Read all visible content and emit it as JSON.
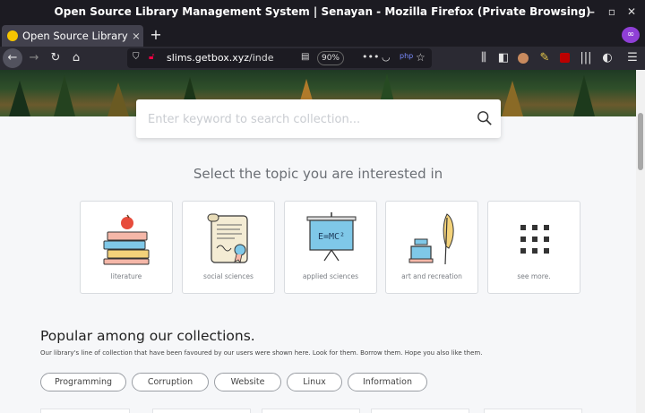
{
  "window": {
    "title": "Open Source Library Management System | Senayan - Mozilla Firefox (Private Browsing)"
  },
  "tab": {
    "label": "Open Source Library Ma",
    "close": "×"
  },
  "nav": {
    "url_host": "slims.getbox.xyz",
    "url_path": "/index.ph",
    "zoom": "90%"
  },
  "search": {
    "placeholder": "Enter keyword to search collection..."
  },
  "topics": {
    "heading": "Select the topic you are interested in",
    "items": [
      {
        "label": "literature",
        "icon": "books-apple-icon"
      },
      {
        "label": "social sciences",
        "icon": "certificate-icon"
      },
      {
        "label": "applied sciences",
        "icon": "projector-emc2-icon"
      },
      {
        "label": "art and recreation",
        "icon": "inkwell-quill-icon"
      },
      {
        "label": "see more.",
        "icon": "grid-dots-icon"
      }
    ]
  },
  "projector_text": "E=MC²",
  "popular": {
    "title": "Popular among our collections.",
    "description": "Our library's line of collection that have been favoured by our users were shown here. Look for them. Borrow them. Hope you also like them.",
    "tags": [
      "Programming",
      "Corruption",
      "Website",
      "Linux",
      "Information"
    ]
  },
  "colors": {
    "chrome_dark": "#1c1b22",
    "toolbar": "#2b2a33",
    "page_bg": "#f6f7f9",
    "accent_private": "#8f3fd6"
  }
}
